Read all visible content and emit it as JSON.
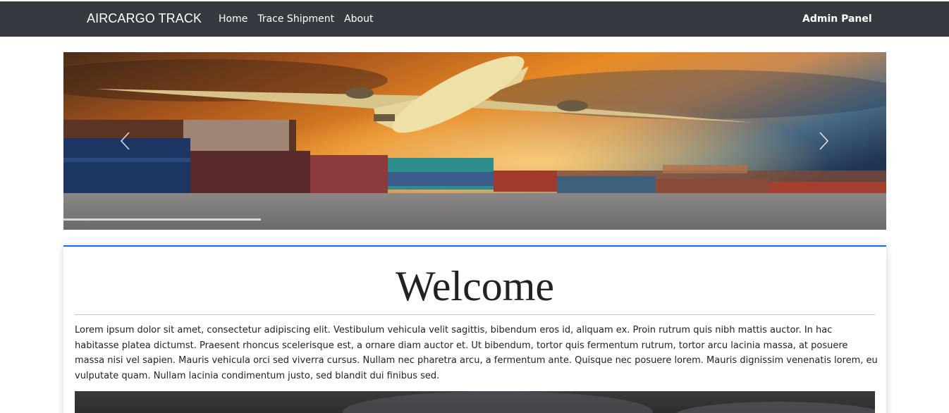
{
  "navbar": {
    "brand": "AIRCARGO TRACK",
    "links": [
      "Home",
      "Trace Shipment",
      "About"
    ],
    "admin_label": "Admin Panel",
    "background": "#343a40"
  },
  "carousel": {
    "prev_icon": "chevron-left-icon",
    "next_icon": "chevron-right-icon",
    "image_description": "cargo-plane-over-container-port"
  },
  "content": {
    "heading": "Welcome",
    "paragraph": "Lorem ipsum dolor sit amet, consectetur adipiscing elit. Vestibulum vehicula velit sagittis, bibendum eros id, aliquam ex. Proin rutrum quis nibh mattis auctor. In hac habitasse platea dictumst. Praesent rhoncus scelerisque est, a ornare diam auctor et. Ut bibendum, tortor quis fermentum rutrum, tortor arcu lacinia massa, at posuere massa nisi vel sapien. Mauris vehicula orci sed viverra cursus. Nullam nec pharetra arcu, a fermentum ante. Quisque nec posuere lorem. Mauris dignissim venenatis lorem, eu vulputate quam. Nullam lacinia condimentum justo, sed blandit dui finibus sed.",
    "accent_color": "#0d6efd"
  }
}
